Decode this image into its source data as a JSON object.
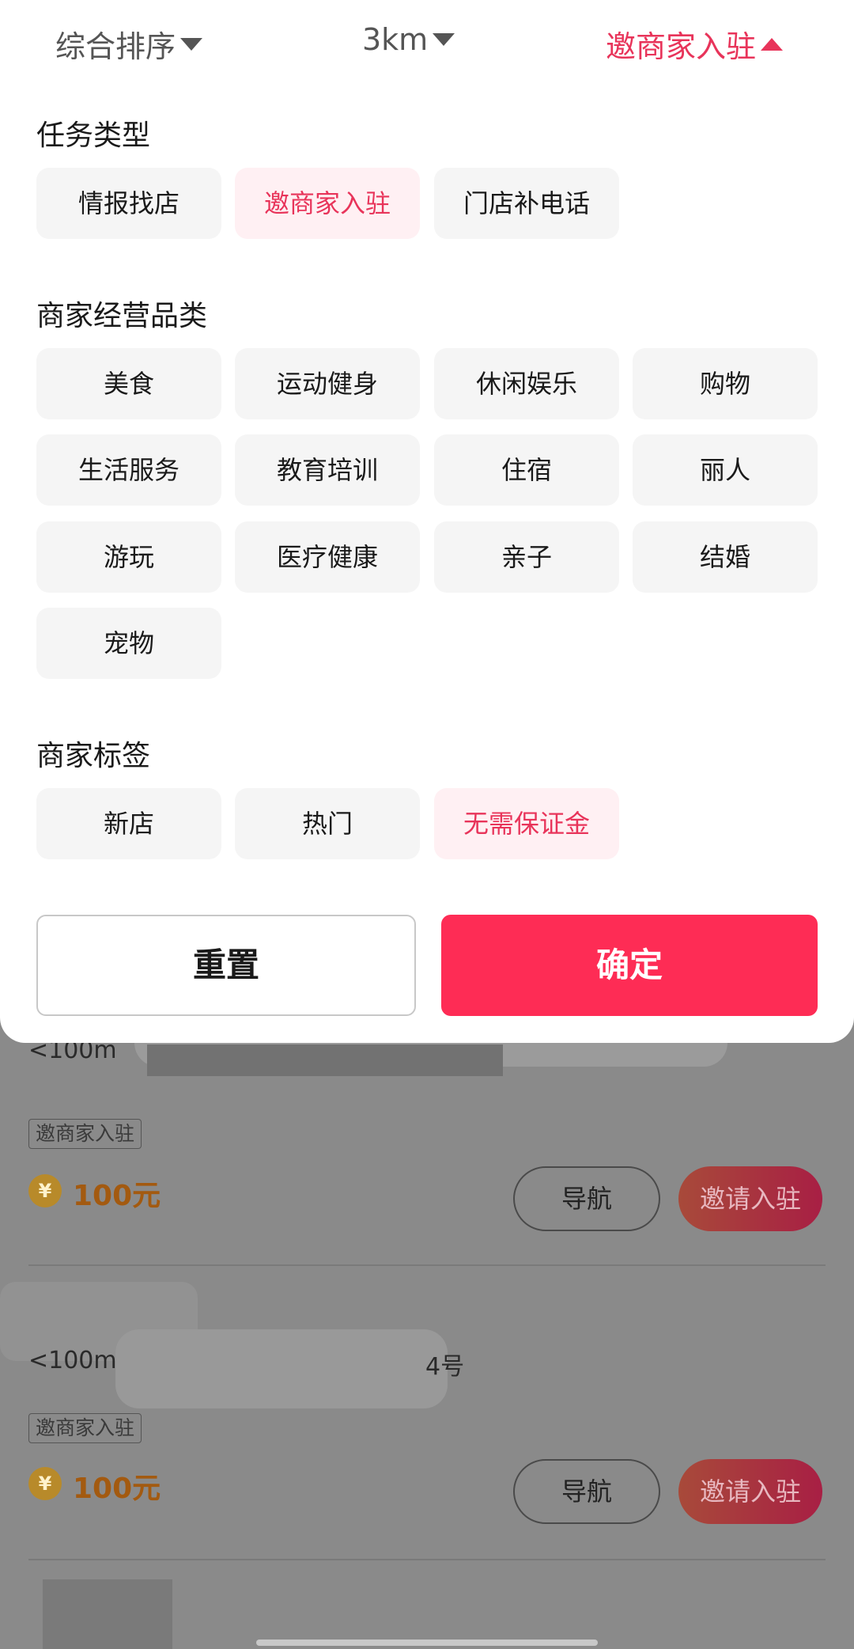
{
  "sort_bar": {
    "sort_label": "综合排序",
    "distance_label": "3km",
    "task_label": "邀商家入驻"
  },
  "task_type": {
    "title": "任务类型",
    "options": [
      "情报找店",
      "邀商家入驻",
      "门店补电话"
    ],
    "selected": "邀商家入驻"
  },
  "category": {
    "title": "商家经营品类",
    "options": [
      "美食",
      "运动健身",
      "休闲娱乐",
      "购物",
      "生活服务",
      "教育培训",
      "住宿",
      "丽人",
      "游玩",
      "医疗健康",
      "亲子",
      "结婚",
      "宠物"
    ]
  },
  "merchant_tags": {
    "title": "商家标签",
    "options": [
      "新店",
      "热门",
      "无需保证金"
    ],
    "selected": "无需保证金"
  },
  "actions": {
    "reset": "重置",
    "confirm": "确定"
  },
  "list": [
    {
      "distance": "<100m",
      "tag": "邀商家入驻",
      "coin": "¥",
      "reward": "100元",
      "nav": "导航",
      "invite": "邀请入驻"
    },
    {
      "distance": "<100m",
      "address_fragment": "4号",
      "tag": "邀商家入驻",
      "coin": "¥",
      "reward": "100元",
      "nav": "导航",
      "invite": "邀请入驻"
    }
  ],
  "colors": {
    "accent": "#fe2c55",
    "accent_text": "#e8345a",
    "selected_chip_bg": "#fff0f3",
    "chip_bg": "#f5f5f5"
  }
}
